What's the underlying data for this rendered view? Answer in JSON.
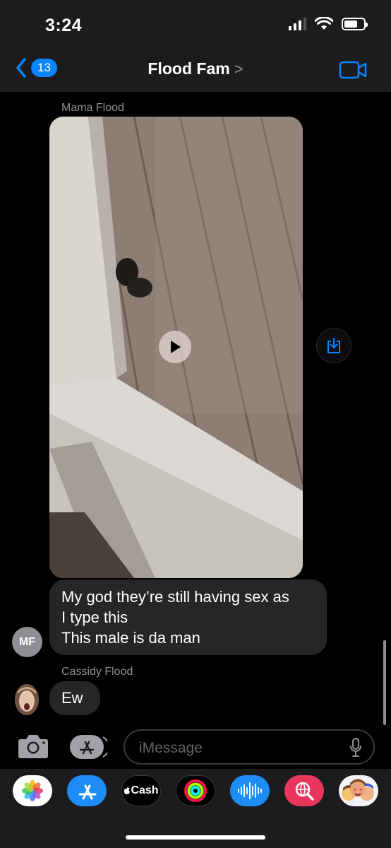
{
  "status_bar": {
    "time": "3:24",
    "battery_level": 0.7
  },
  "header": {
    "back_badge": "13",
    "title": "Flood Fam",
    "chevron": ">"
  },
  "messages": [
    {
      "sender": "Mama Flood",
      "type": "video",
      "save_icon": "save-to-photos-icon"
    },
    {
      "type": "text",
      "lines": [
        "My god they’re still having sex as",
        "I type this",
        "This male is da man"
      ],
      "avatar_initials": "MF"
    },
    {
      "sender": "Cassidy Flood",
      "type": "text",
      "lines": [
        "Ew"
      ]
    }
  ],
  "input": {
    "placeholder": "iMessage"
  },
  "app_drawer": {
    "apps": [
      {
        "name": "photos-app-icon"
      },
      {
        "name": "app-store-app-icon"
      },
      {
        "name": "apple-cash-app-icon",
        "label": "Cash"
      },
      {
        "name": "activity-app-icon"
      },
      {
        "name": "audio-message-app-icon"
      },
      {
        "name": "images-search-app-icon"
      },
      {
        "name": "memoji-app-icon"
      }
    ]
  },
  "colors": {
    "accent": "#0a84ff",
    "bubble": "#262628",
    "bar": "#1c1c1e"
  }
}
